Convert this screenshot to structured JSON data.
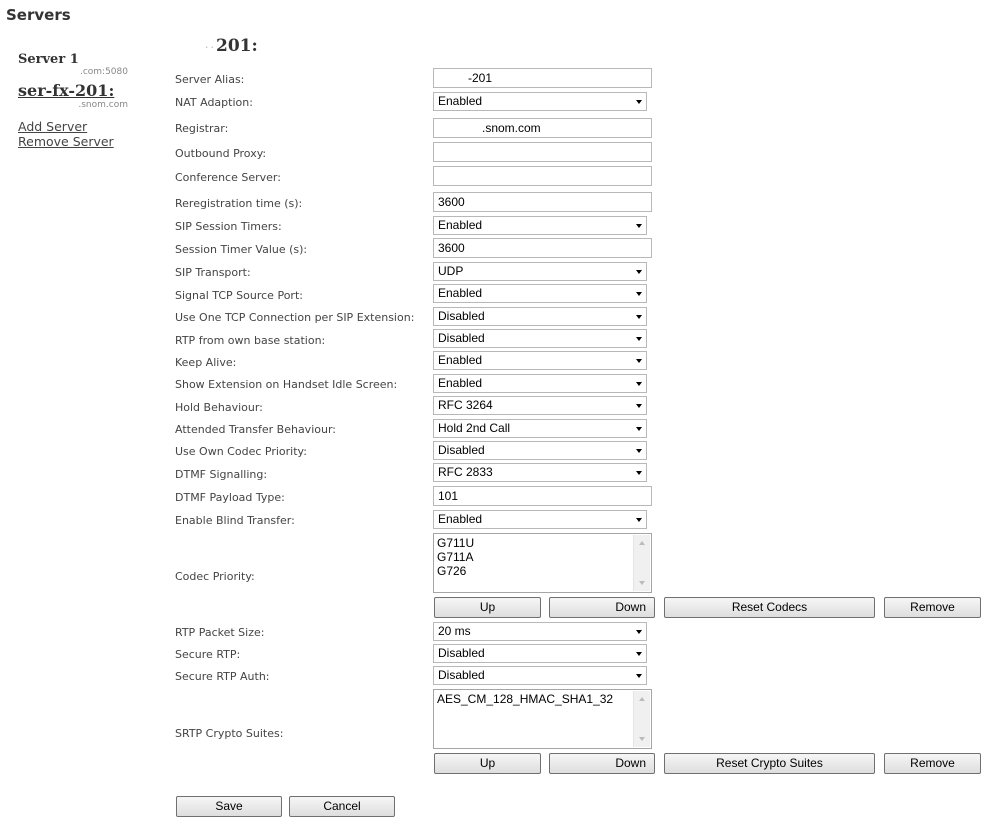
{
  "page": {
    "title": "Servers"
  },
  "sidebar": {
    "server1_name": "Server 1",
    "server1_host": ".com:5080",
    "server2_name": "ser-fx-201:",
    "server2_host": ".snom.com",
    "add_server": "Add Server",
    "remove_server": "Remove Server"
  },
  "form": {
    "title": "201:",
    "server_alias": {
      "label": "Server Alias:",
      "value": "-201"
    },
    "nat_adaption": {
      "label": "NAT Adaption:",
      "value": "Enabled"
    },
    "registrar": {
      "label": "Registrar:",
      "value": ".snom.com"
    },
    "outbound_proxy": {
      "label": "Outbound Proxy:",
      "value": ""
    },
    "conference_server": {
      "label": "Conference Server:",
      "value": ""
    },
    "reregistration_time": {
      "label": "Reregistration time (s):",
      "value": "3600"
    },
    "sip_session_timers": {
      "label": "SIP Session Timers:",
      "value": "Enabled"
    },
    "session_timer_value": {
      "label": "Session Timer Value (s):",
      "value": "3600"
    },
    "sip_transport": {
      "label": "SIP Transport:",
      "value": "UDP"
    },
    "signal_tcp_source_port": {
      "label": "Signal TCP Source Port:",
      "value": "Enabled"
    },
    "one_tcp_connection": {
      "label": "Use One TCP Connection per SIP Extension:",
      "value": "Disabled"
    },
    "rtp_own_base": {
      "label": "RTP from own base station:",
      "value": "Disabled"
    },
    "keep_alive": {
      "label": "Keep Alive:",
      "value": "Enabled"
    },
    "show_extension": {
      "label": "Show Extension on Handset Idle Screen:",
      "value": "Enabled"
    },
    "hold_behaviour": {
      "label": "Hold Behaviour:",
      "value": "RFC 3264"
    },
    "attended_transfer": {
      "label": "Attended Transfer Behaviour:",
      "value": "Hold 2nd Call"
    },
    "own_codec_priority": {
      "label": "Use Own Codec Priority:",
      "value": "Disabled"
    },
    "dtmf_signalling": {
      "label": "DTMF Signalling:",
      "value": "RFC 2833"
    },
    "dtmf_payload_type": {
      "label": "DTMF Payload Type:",
      "value": "101"
    },
    "blind_transfer": {
      "label": "Enable Blind Transfer:",
      "value": "Enabled"
    },
    "codec_priority": {
      "label": "Codec Priority:",
      "items": [
        "G711U",
        "G711A",
        "G726"
      ],
      "up": "Up",
      "down": "Down",
      "reset": "Reset Codecs",
      "remove": "Remove"
    },
    "rtp_packet_size": {
      "label": "RTP Packet Size:",
      "value": "20 ms"
    },
    "secure_rtp": {
      "label": "Secure RTP:",
      "value": "Disabled"
    },
    "secure_rtp_auth": {
      "label": "Secure RTP Auth:",
      "value": "Disabled"
    },
    "srtp_crypto_suites": {
      "label": "SRTP Crypto Suites:",
      "items": [
        "AES_CM_128_HMAC_SHA1_32"
      ],
      "up": "Up",
      "down": "Down",
      "reset": "Reset Crypto Suites",
      "remove": "Remove"
    },
    "save": "Save",
    "cancel": "Cancel"
  }
}
